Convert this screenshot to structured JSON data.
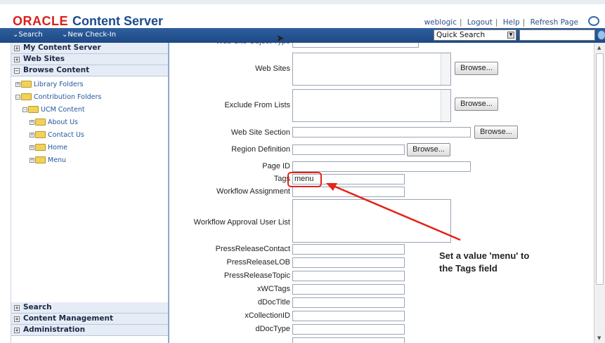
{
  "header": {
    "logo_oracle": "ORACLE",
    "logo_cs": "Content Server",
    "links": [
      "weblogic",
      "Logout",
      "Help",
      "Refresh Page"
    ]
  },
  "navbar": {
    "search": "⌄Search",
    "new_checkin": "⌄New Check-In",
    "quick_search": "Quick Search",
    "search_input": ""
  },
  "sidebar": {
    "my_content_server": "My Content Server",
    "web_sites": "Web Sites",
    "browse_content": "Browse Content",
    "tree": [
      {
        "label": "Library Folders",
        "level": 0
      },
      {
        "label": "Contribution Folders",
        "level": 0
      },
      {
        "label": "UCM Content",
        "level": 1
      },
      {
        "label": "About Us",
        "level": 2
      },
      {
        "label": "Contact Us",
        "level": 2
      },
      {
        "label": "Home",
        "level": 2
      },
      {
        "label": "Menu",
        "level": 2
      }
    ],
    "search": "Search",
    "content_management": "Content Management",
    "administration": "Administration"
  },
  "form": {
    "web_site_object_type": "Web Site Object Type",
    "web_sites": "Web Sites",
    "exclude_from_lists": "Exclude From Lists",
    "web_site_section": "Web Site Section",
    "region_definition": "Region Definition",
    "page_id": "Page ID",
    "tags": "Tags",
    "tags_value": "menu",
    "workflow_assignment": "Workflow Assignment",
    "workflow_approval_user_list": "Workflow Approval User List",
    "press_release_contact": "PressReleaseContact",
    "press_release_lob": "PressReleaseLOB",
    "press_release_topic": "PressReleaseTopic",
    "xwc_tags": "xWCTags",
    "ddoc_title": "dDocTitle",
    "xcollection_id": "xCollectionID",
    "ddoc_type": "dDocType",
    "browse": "Browse..."
  },
  "annotation": {
    "line1": "Set a value 'menu' to",
    "line2": "the Tags field",
    "color": "#e3231b"
  }
}
